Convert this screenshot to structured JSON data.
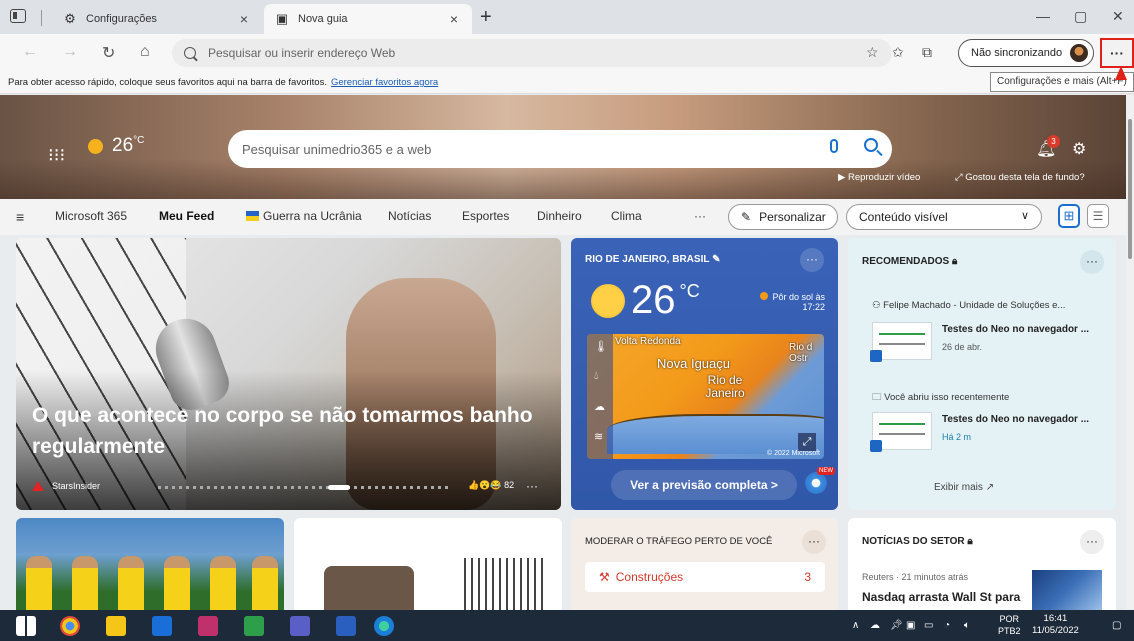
{
  "browser": {
    "tabs": [
      {
        "label": "Configurações",
        "close": "×"
      },
      {
        "label": "Nova guia",
        "close": "×"
      }
    ],
    "new_tab": "+",
    "window": {
      "minimize": "—",
      "restore": "▢",
      "close": "✕"
    },
    "address_placeholder": "Pesquisar ou inserir endereço Web",
    "sync_label": "Não sincronizando",
    "more_label": "···",
    "tooltip": "Configurações e mais (Alt+F)",
    "favorites_bar": {
      "text": "Para obter acesso rápido, coloque seus favoritos aqui na barra de favoritos.",
      "link": "Gerenciar favoritos agora"
    }
  },
  "hero": {
    "temperature": "26",
    "unit": "°C",
    "search_placeholder": "Pesquisar unimedrio365 e a web",
    "notification_count": "3",
    "play_video": "Reproduzir vídeo",
    "liked_background": "Gostou desta tela de fundo?"
  },
  "feed_nav": {
    "items": [
      "Microsoft 365",
      "Meu Feed",
      "Guerra na Ucrânia",
      "Notícias",
      "Esportes",
      "Dinheiro",
      "Clima"
    ],
    "more": "···",
    "personalize": "Personalizar",
    "content_visibility": "Conteúdo visível"
  },
  "main_story": {
    "headline": "O que acontece no corpo se não tomarmos banho regularmente",
    "source": "StarsInsider",
    "reactions": "82",
    "more": "···"
  },
  "weather_card": {
    "location": "RIO DE JANEIRO, BRASIL",
    "temperature": "26",
    "unit": "°C",
    "sunset_label": "Pôr do sol às",
    "sunset_time": "17:22",
    "map_labels": [
      "Volta Redonda",
      "Nova Iguaçu",
      "Rio de Janeiro",
      "Rio d Ostr"
    ],
    "map_credit": "© 2022 Microsoft",
    "forecast_button": "Ver a previsão completa >",
    "new_badge": "NEW",
    "more": "···"
  },
  "recommended": {
    "title": "RECOMENDADOS",
    "user_line": "Felipe Machado - Unidade de Soluções e...",
    "items": [
      {
        "title": "Testes do Neo no navegador ...",
        "date": "26 de abr."
      },
      {
        "title": "Testes do Neo no navegador ...",
        "date": "Há 2 m"
      }
    ],
    "recent_label": "Você abriu isso recentemente",
    "show_more": "Exibir mais",
    "more": "···"
  },
  "traffic_card": {
    "title": "MODERAR O TRÁFEGO PERTO DE VOCÊ",
    "row_label": "Construções",
    "row_count": "3",
    "more": "···"
  },
  "industry_news": {
    "title": "NOTÍCIAS DO SETOR",
    "source": "Reuters · 21 minutos atrás",
    "headline": "Nasdaq arrasta Wall St para",
    "more": "···"
  },
  "taskbar": {
    "language_top": "POR",
    "language_bottom": "PTB2",
    "time": "16:41",
    "date": "11/05/2022"
  }
}
